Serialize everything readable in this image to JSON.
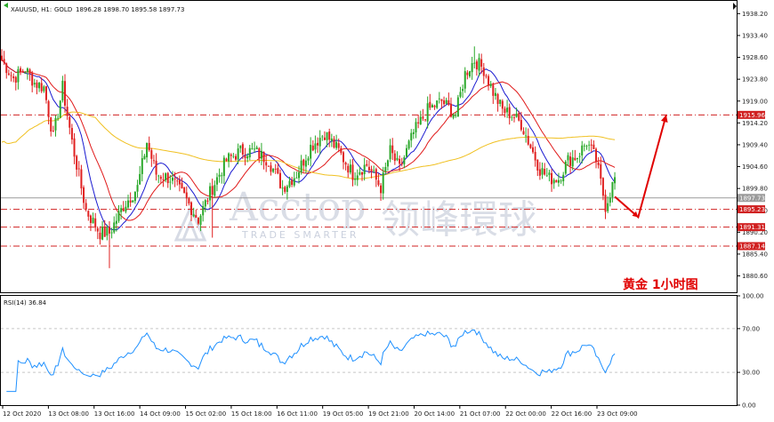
{
  "header": {
    "symbol": "XAUUSD, H1:",
    "name": "GOLD",
    "ohlc": "1896.28 1898.70 1895.58 1897.73"
  },
  "watermark": {
    "brand": "Acctop",
    "brand_cn": "领峰環球",
    "tagline": "TRADE SMARTER"
  },
  "annotation": {
    "text": "黄金    1小时图"
  },
  "colors": {
    "bull": "#2aa82a",
    "bear": "#e02020",
    "ma_fast": "#1a1ad0",
    "ma_mid": "#e01a1a",
    "ma_slow": "#f0c020",
    "rsi": "#1e90ff",
    "level": "#d02020",
    "current": "#9a9a9a",
    "arrow": "#e00000"
  },
  "chart_data": [
    {
      "type": "candlestick",
      "ylim": [
        1877.0,
        1941.0
      ],
      "y_ticks": [
        "1938.20",
        "1933.40",
        "1928.60",
        "1923.80",
        "1919.00",
        "1914.20",
        "1909.40",
        "1904.60",
        "1899.80",
        "1895.00",
        "1890.20",
        "1885.40",
        "1880.60"
      ],
      "x_ticks": [
        "12 Oct 2020",
        "13 Oct 08:00",
        "13 Oct 16:00",
        "14 Oct 09:00",
        "15 Oct 02:00",
        "15 Oct 18:00",
        "16 Oct 11:00",
        "19 Oct 05:00",
        "19 Oct 21:00",
        "20 Oct 14:00",
        "21 Oct 07:00",
        "22 Oct 00:00",
        "22 Oct 16:00",
        "23 Oct 09:00"
      ],
      "anchors": [
        [
          0,
          1928
        ],
        [
          5,
          1924
        ],
        [
          10,
          1926
        ],
        [
          14,
          1923
        ],
        [
          18,
          1922
        ],
        [
          22,
          1911
        ],
        [
          26,
          1922
        ],
        [
          30,
          1910
        ],
        [
          36,
          1895
        ],
        [
          42,
          1890
        ],
        [
          46,
          1890
        ],
        [
          52,
          1896
        ],
        [
          58,
          1900
        ],
        [
          62,
          1910
        ],
        [
          66,
          1903
        ],
        [
          72,
          1902
        ],
        [
          78,
          1898
        ],
        [
          84,
          1893
        ],
        [
          90,
          1900
        ],
        [
          96,
          1906
        ],
        [
          102,
          1908
        ],
        [
          108,
          1908
        ],
        [
          114,
          1906
        ],
        [
          120,
          1900
        ],
        [
          126,
          1903
        ],
        [
          132,
          1909
        ],
        [
          138,
          1912
        ],
        [
          144,
          1908
        ],
        [
          150,
          1903
        ],
        [
          156,
          1905
        ],
        [
          162,
          1900
        ],
        [
          166,
          1908
        ],
        [
          170,
          1904
        ],
        [
          176,
          1912
        ],
        [
          182,
          1917
        ],
        [
          188,
          1919
        ],
        [
          194,
          1916
        ],
        [
          198,
          1925
        ],
        [
          202,
          1928
        ],
        [
          206,
          1926
        ],
        [
          210,
          1921
        ],
        [
          214,
          1917
        ],
        [
          218,
          1916
        ],
        [
          222,
          1914
        ],
        [
          226,
          1909
        ],
        [
          230,
          1904
        ],
        [
          234,
          1902
        ],
        [
          238,
          1902
        ],
        [
          242,
          1906
        ],
        [
          246,
          1907
        ],
        [
          250,
          1910
        ],
        [
          254,
          1906
        ],
        [
          258,
          1896
        ],
        [
          262,
          1902
        ]
      ],
      "series": [
        {
          "name": "",
          "kind": "ma",
          "period": 10
        },
        {
          "name": "",
          "kind": "ma",
          "period": 20
        },
        {
          "name": "",
          "kind": "ma",
          "period": 120
        }
      ],
      "levels": [
        {
          "label": "1915.96",
          "value": 1915.96,
          "style": "dashdot"
        },
        {
          "label": "1895.23",
          "value": 1895.23,
          "style": "dashdot"
        },
        {
          "label": "1891.31",
          "value": 1891.31,
          "style": "dashdot"
        },
        {
          "label": "1887.14",
          "value": 1887.14,
          "style": "dashdot"
        },
        {
          "label": "1897.73",
          "value": 1897.73,
          "style": "current"
        }
      ],
      "projection": [
        [
          262,
          1898
        ],
        [
          272,
          1893.5
        ],
        [
          284,
          1916
        ]
      ]
    },
    {
      "type": "line",
      "title": "RSI(14) 36.84",
      "ylim": [
        0,
        100
      ],
      "y_ticks": [
        "100.00",
        "70.00",
        "30.00",
        "0.00"
      ],
      "ref_lines": [
        70,
        30
      ]
    }
  ]
}
